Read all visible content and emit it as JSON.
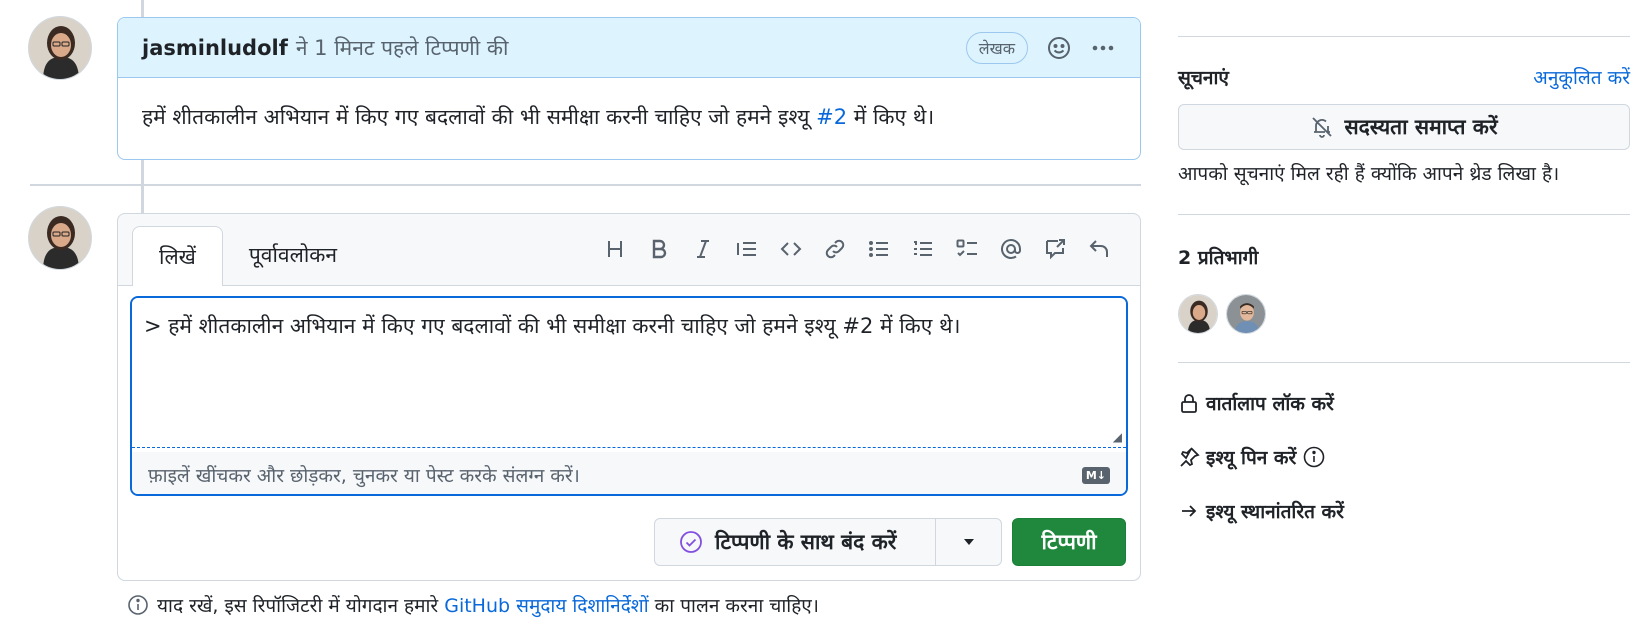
{
  "comment": {
    "author": "jasminludolf",
    "meta": "ने 1 मिनट पहले टिप्पणी की",
    "badge": "लेखक",
    "body_prefix": "हमें शीतकालीन अभियान में किए गए बदलावों की भी समीक्षा करनी चाहिए जो हमने इश्यू ",
    "body_link": "#2",
    "body_suffix": " में किए थे।"
  },
  "composer": {
    "tabs": [
      "लिखें",
      "पूर्वावलोकन"
    ],
    "toolbar_icons": [
      "heading-icon",
      "bold-icon",
      "italic-icon",
      "quote-icon",
      "code-icon",
      "link-icon",
      "unordered-list-icon",
      "ordered-list-icon",
      "task-list-icon",
      "mention-icon",
      "cross-reference-icon",
      "reply-icon"
    ],
    "textarea_value": "> हमें शीतकालीन अभियान में किए गए बदलावों की भी समीक्षा करनी चाहिए जो हमने इश्यू #2 में किए थे।",
    "attach_hint": "फ़ाइलें खींचकर और छोड़कर, चुनकर या पेस्ट करके संलग्न करें।",
    "markdown_badge": "M↓",
    "close_label": "टिप्पणी के साथ बंद करें",
    "comment_label": "टिप्पणी"
  },
  "guidelines": {
    "prefix": "याद रखें, इस रिपॉजिटरी में योगदान हमारे ",
    "link": "GitHub समुदाय दिशानिर्देशों",
    "suffix": " का पालन करना चाहिए।"
  },
  "sidebar": {
    "notifications_heading": "सूचनाएं",
    "customize_link": "अनुकूलित करें",
    "unsubscribe_label": "सदस्यता समाप्त करें",
    "subscription_note": "आपको सूचनाएं मिल रही हैं क्योंकि आपने थ्रेड लिखा है।",
    "participants_heading": "2 प्रतिभागी",
    "lock_label": "वार्तालाप लॉक करें",
    "pin_label": "इश्यू पिन करें",
    "transfer_label": "इश्यू स्थानांतरित करें"
  },
  "colors": {
    "accent": "#0969da",
    "header_bg": "#ddf4ff",
    "primary_button": "#1f883d",
    "done_icon": "#8250df"
  }
}
